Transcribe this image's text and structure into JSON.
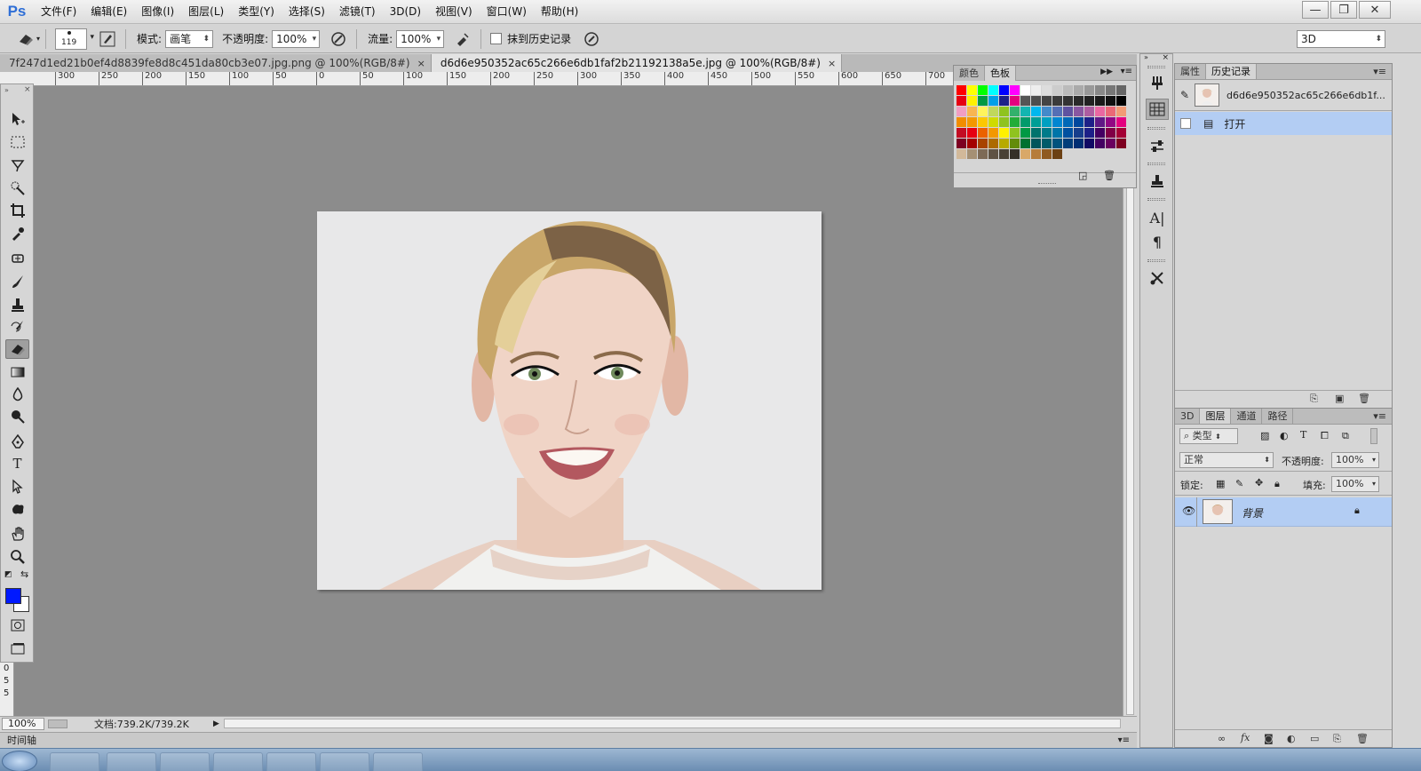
{
  "app": {
    "logo": "Ps"
  },
  "menu": [
    "文件(F)",
    "编辑(E)",
    "图像(I)",
    "图层(L)",
    "类型(Y)",
    "选择(S)",
    "滤镜(T)",
    "3D(D)",
    "视图(V)",
    "窗口(W)",
    "帮助(H)"
  ],
  "window_controls": {
    "minimize": "—",
    "restore": "❐",
    "close": "✕"
  },
  "options": {
    "brush_size": "119",
    "mode_label": "模式:",
    "mode_value": "画笔",
    "opacity_label": "不透明度:",
    "opacity_value": "100%",
    "flow_label": "流量:",
    "flow_value": "100%",
    "erase_history_label": "抹到历史记录",
    "workspace_value": "3D"
  },
  "doc_tabs": [
    {
      "title": "7f247d1ed21b0ef4d8839fe8d8c451da80cb3e07.jpg.png @ 100%(RGB/8#)",
      "close": "×"
    },
    {
      "title": "d6d6e950352ac65c266e6db1faf2b21192138a5e.jpg @ 100%(RGB/8#)",
      "close": "×"
    }
  ],
  "ruler_top": [
    "300",
    "250",
    "200",
    "150",
    "100",
    "50",
    "0",
    "50",
    "100",
    "150",
    "200",
    "250",
    "300",
    "350",
    "400",
    "450",
    "500",
    "550",
    "600",
    "650",
    "700"
  ],
  "ruler_left": [
    "0",
    "5",
    "5"
  ],
  "status": {
    "zoom": "100%",
    "doc_info": "文档:739.2K/739.2K",
    "arrow": "▶"
  },
  "timeline": {
    "label": "时间轴"
  },
  "swatches_panel": {
    "tabs": [
      "颜色",
      "色板"
    ],
    "active_tab": 1,
    "colors": [
      "#ff0000",
      "#ffff00",
      "#00ff00",
      "#00ffff",
      "#0000ff",
      "#ff00ff",
      "#ffffff",
      "#eeeeee",
      "#dddddd",
      "#cccccc",
      "#bbbbbb",
      "#aaaaaa",
      "#999999",
      "#888888",
      "#777777",
      "#666666",
      "#e60012",
      "#fff100",
      "#009944",
      "#00a0e9",
      "#1d2088",
      "#e4007f",
      "#555555",
      "#4d4d4d",
      "#444444",
      "#3b3b3b",
      "#333333",
      "#2a2a2a",
      "#222222",
      "#1a1a1a",
      "#111111",
      "#000000",
      "#f19ec2",
      "#f8b551",
      "#fff45c",
      "#c0d85c",
      "#8fc31f",
      "#32b16c",
      "#13b5b1",
      "#00b7ee",
      "#448aca",
      "#556fb5",
      "#5f52a0",
      "#8957a1",
      "#ae5da1",
      "#ea68a2",
      "#eb6877",
      "#f29b76",
      "#f18d00",
      "#f39800",
      "#fcc800",
      "#cfdb00",
      "#8fc320",
      "#22ac38",
      "#009b6b",
      "#009e96",
      "#00a0c1",
      "#0086d1",
      "#0068b7",
      "#00479d",
      "#1d2088",
      "#601986",
      "#920783",
      "#e4007f",
      "#c30d23",
      "#e60012",
      "#eb6100",
      "#f39800",
      "#fff100",
      "#8fc31f",
      "#009944",
      "#00736d",
      "#007b8a",
      "#0075a9",
      "#0050a0",
      "#173e8c",
      "#1d2088",
      "#440062",
      "#800046",
      "#a40035",
      "#7d0022",
      "#a40000",
      "#a84200",
      "#ac6a00",
      "#b7aa00",
      "#638c0b",
      "#007130",
      "#00555b",
      "#005c6a",
      "#00527d",
      "#003e7a",
      "#002e73",
      "#100964",
      "#440062",
      "#6a005f",
      "#7e0021",
      "#d2b99a",
      "#a59074",
      "#7d6a56",
      "#5f5243",
      "#494135",
      "#353028",
      "#d9a868",
      "#b67c3a",
      "#8f5a21",
      "#6b4013"
    ]
  },
  "history_panel": {
    "tabs": [
      "属性",
      "历史记录"
    ],
    "active_tab": 1,
    "snapshot_name": "d6d6e950352ac65c266e6db1f...",
    "items": [
      {
        "label": "打开"
      }
    ]
  },
  "layers_panel": {
    "tabs": [
      "3D",
      "图层",
      "通道",
      "路径"
    ],
    "active_tab": 1,
    "filter_kind": "类型",
    "blend_mode": "正常",
    "opacity_label": "不透明度:",
    "opacity_value": "100%",
    "lock_label": "锁定:",
    "fill_label": "填充:",
    "fill_value": "100%",
    "layers": [
      {
        "name": "背景",
        "visible": true,
        "locked": true
      }
    ],
    "footer_icons": [
      "link-icon",
      "fx-icon",
      "mask-icon",
      "adjustment-icon",
      "group-icon",
      "new-layer-icon",
      "trash-icon"
    ],
    "footer_fx": "fx"
  },
  "side_strip": {
    "type_glyph": "A|",
    "paragraph_glyph": "¶"
  },
  "colors": {
    "foreground": "#0019ff",
    "background": "#ffffff",
    "canvas_bg": "#8c8c8c",
    "selection": "#b3cdf3"
  }
}
